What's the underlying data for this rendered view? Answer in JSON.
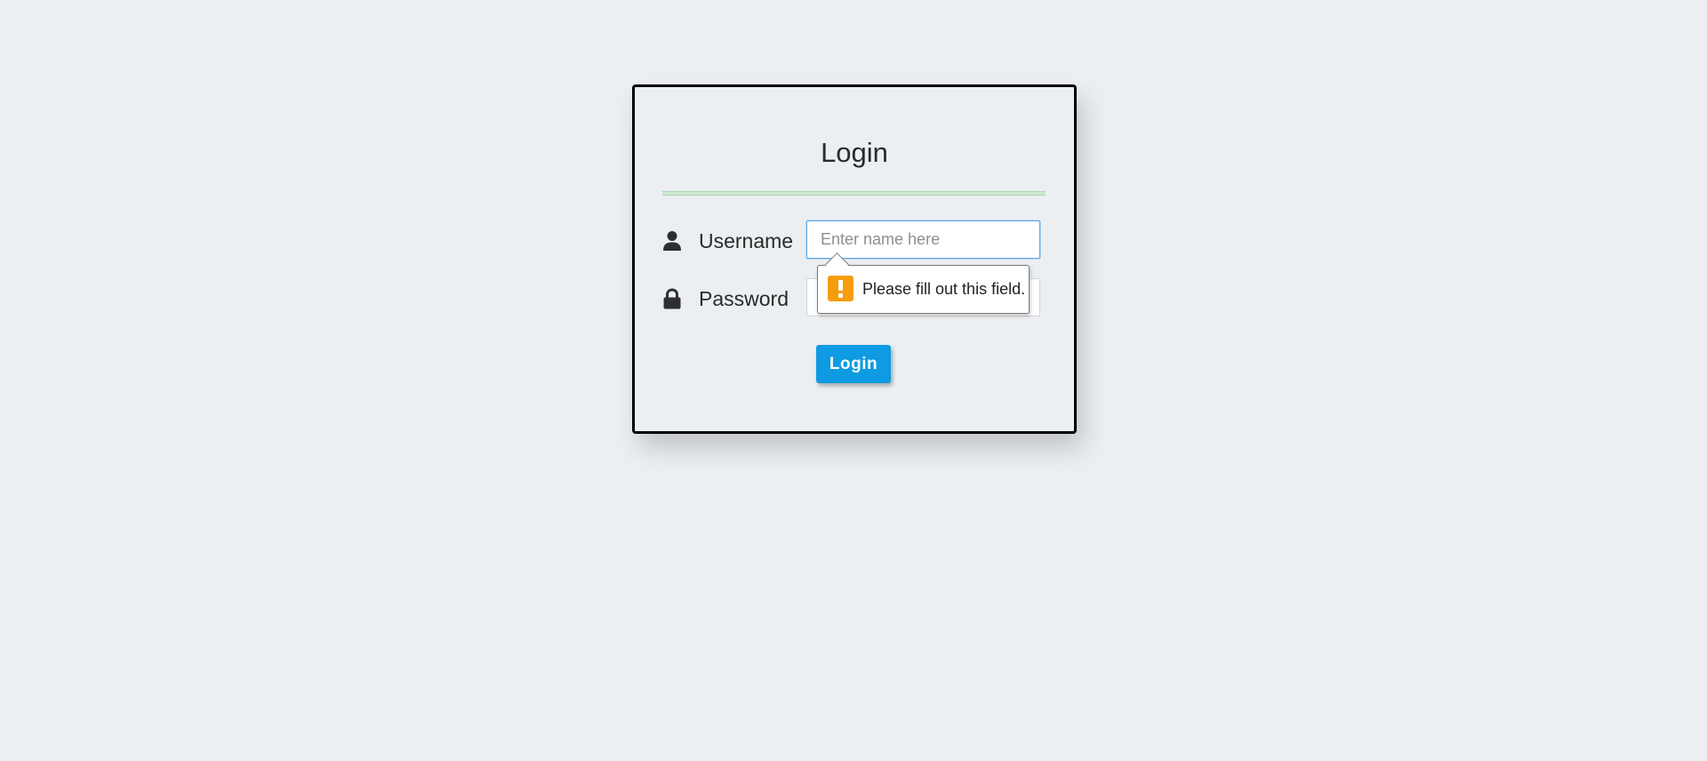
{
  "login_form": {
    "title": "Login",
    "username": {
      "label": "Username",
      "placeholder": "Enter name here",
      "value": "",
      "icon": "user-icon"
    },
    "password": {
      "label": "Password",
      "placeholder": "",
      "value": "",
      "icon": "lock-icon"
    },
    "submit_label": "Login"
  },
  "validation_tooltip": {
    "message": "Please fill out this field.",
    "icon": "warning-icon"
  },
  "colors": {
    "background": "#eceff2",
    "button": "#0e9be3",
    "divider": "#a6d8b0",
    "warning": "#f59d0c",
    "focus_border": "#5fa8e6"
  }
}
